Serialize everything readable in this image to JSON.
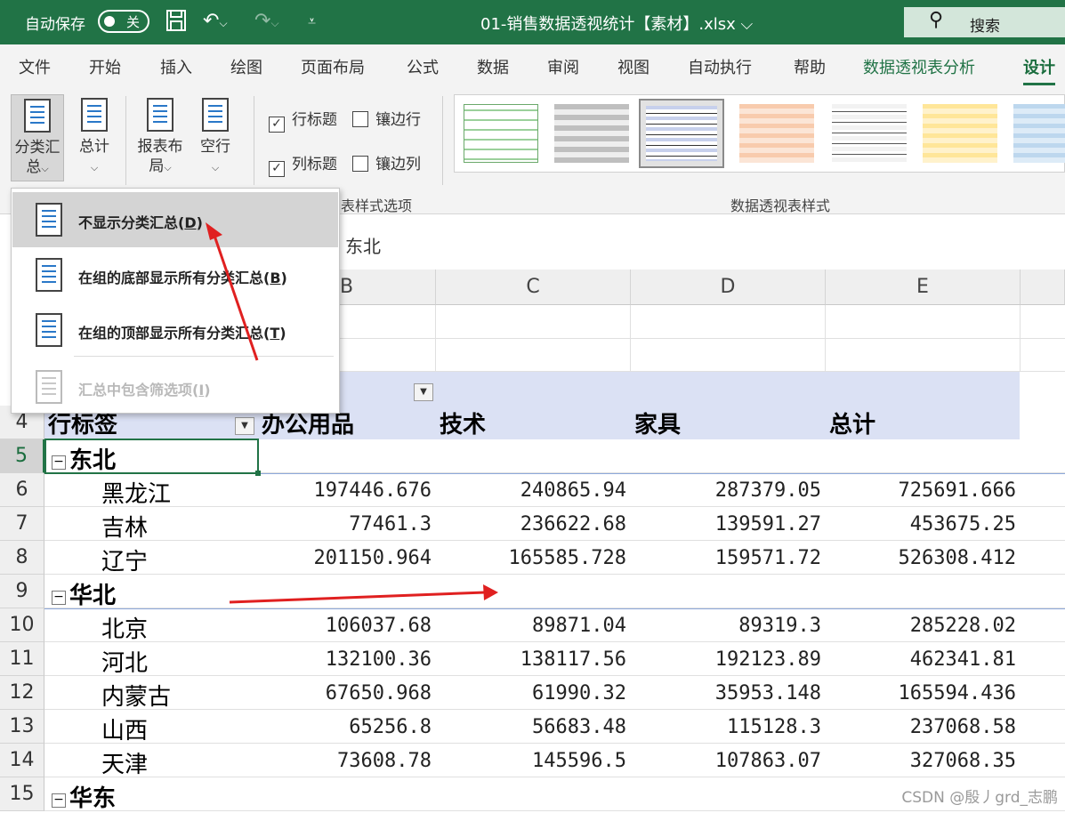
{
  "titlebar": {
    "autosave_label": "自动保存",
    "autosave_state": "关",
    "document_title": "01-销售数据透视统计【素材】.xlsx ⌵",
    "search_label": "搜索",
    "background_color": "#217346"
  },
  "tabs": [
    "文件",
    "开始",
    "插入",
    "绘图",
    "页面布局",
    "公式",
    "数据",
    "审阅",
    "视图",
    "自动执行",
    "帮助",
    "数据透视表分析",
    "设计"
  ],
  "ribbon": {
    "buttons": [
      {
        "label": "分类汇总",
        "line1": "分类汇",
        "line2": "总"
      },
      {
        "label": "总计",
        "line1": "总计",
        "line2": ""
      },
      {
        "label": "报表布局",
        "line1": "报表布",
        "line2": "局"
      },
      {
        "label": "空行",
        "line1": "空行",
        "line2": ""
      }
    ],
    "checkboxes": {
      "row_headers": {
        "label": "行标题",
        "checked": true
      },
      "banded_rows": {
        "label": "镶边行",
        "checked": false
      },
      "col_headers": {
        "label": "列标题",
        "checked": true
      },
      "banded_cols": {
        "label": "镶边列",
        "checked": false
      }
    },
    "style_options_group": "表样式选项",
    "styles_group": "数据透视表样式"
  },
  "dropdown": {
    "items": [
      {
        "label": "不显示分类汇总",
        "key": "D",
        "state": "hover"
      },
      {
        "label": "在组的底部显示所有分类汇总",
        "key": "B",
        "state": "enabled"
      },
      {
        "label": "在组的顶部显示所有分类汇总",
        "key": "T",
        "state": "enabled"
      },
      {
        "label": "汇总中包含筛选项",
        "key": "I",
        "state": "disabled"
      }
    ]
  },
  "formula_bar": {
    "value": "东北"
  },
  "grid": {
    "columns": [
      "B",
      "C",
      "D",
      "E"
    ],
    "row_numbers": [
      "4",
      "5",
      "6",
      "7",
      "8",
      "9",
      "10",
      "11",
      "12",
      "13",
      "14",
      "15"
    ],
    "header_row": [
      "行标签",
      "办公用品",
      "技术",
      "家具",
      "总计"
    ],
    "groups": [
      {
        "region": "东北",
        "rows": [
          {
            "name": "黑龙江",
            "values": [
              "197446.676",
              "240865.94",
              "287379.05",
              "725691.666"
            ]
          },
          {
            "name": "吉林",
            "values": [
              "77461.3",
              "236622.68",
              "139591.27",
              "453675.25"
            ]
          },
          {
            "name": "辽宁",
            "values": [
              "201150.964",
              "165585.728",
              "159571.72",
              "526308.412"
            ]
          }
        ]
      },
      {
        "region": "华北",
        "rows": [
          {
            "name": "北京",
            "values": [
              "106037.68",
              "89871.04",
              "89319.3",
              "285228.02"
            ]
          },
          {
            "name": "河北",
            "values": [
              "132100.36",
              "138117.56",
              "192123.89",
              "462341.81"
            ]
          },
          {
            "name": "内蒙古",
            "values": [
              "67650.968",
              "61990.32",
              "35953.148",
              "165594.436"
            ]
          },
          {
            "name": "山西",
            "values": [
              "65256.8",
              "56683.48",
              "115128.3",
              "237068.58"
            ]
          },
          {
            "name": "天津",
            "values": [
              "73608.78",
              "145596.5",
              "107863.07",
              "327068.35"
            ]
          }
        ]
      },
      {
        "region": "华东",
        "rows": []
      }
    ]
  },
  "watermark": "CSDN @殷丿grd_志鹏",
  "colors": {
    "accent": "#217346",
    "pivot_header": "#dbe1f4",
    "annotation_arrow": "#e02020"
  }
}
